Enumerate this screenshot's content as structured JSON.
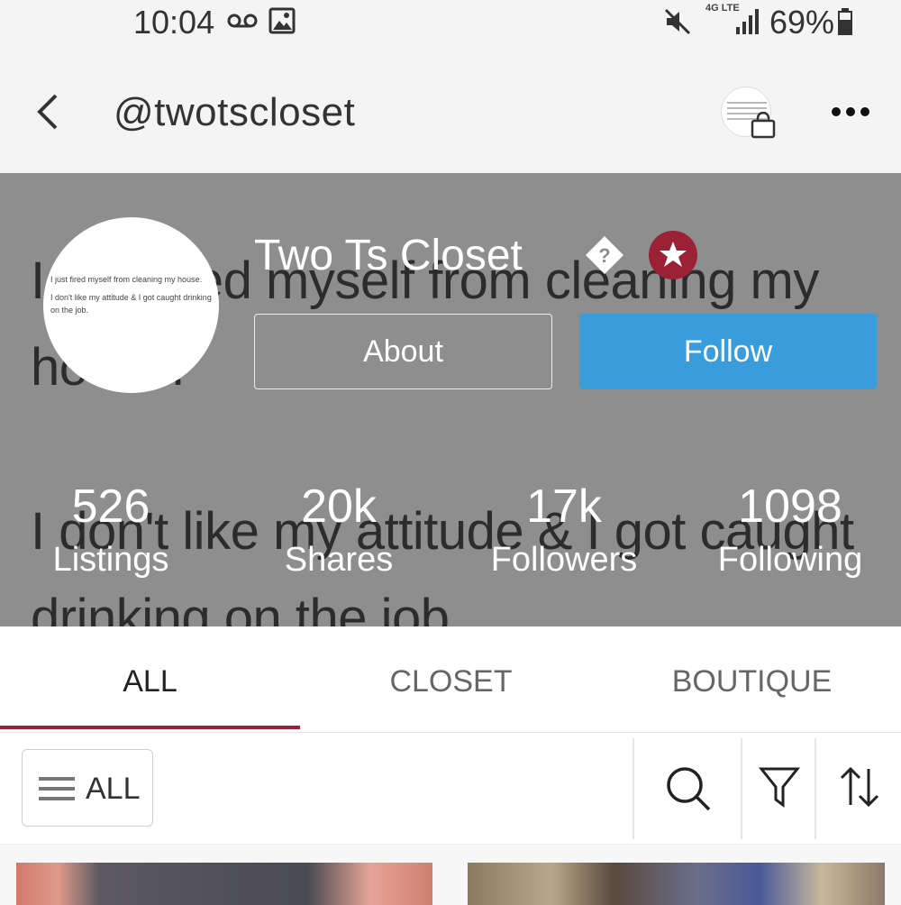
{
  "status_bar": {
    "time": "10:04",
    "network": "4G LTE",
    "battery": "69%"
  },
  "header": {
    "handle": "@twotscloset"
  },
  "profile": {
    "banner_lines": [
      "I just fired myself from cleaning my house.",
      "I don't like my attitude & I got caught drinking on the job."
    ],
    "avatar_lines": [
      "I just fired myself from cleaning my house.",
      "I don't like my attitude & I got caught drinking on the job."
    ],
    "shop_name": "Two Ts Closet",
    "about_label": "About",
    "follow_label": "Follow",
    "colors": {
      "follow": "#3a9ddb",
      "badge": "#9b2236",
      "banner": "#8e8e8e"
    }
  },
  "stats": [
    {
      "value": "526",
      "label": "Listings"
    },
    {
      "value": "20k",
      "label": "Shares"
    },
    {
      "value": "17k",
      "label": "Followers"
    },
    {
      "value": "1098",
      "label": "Following"
    }
  ],
  "tabs": [
    {
      "label": "ALL",
      "active": true
    },
    {
      "label": "CLOSET",
      "active": false
    },
    {
      "label": "BOUTIQUE",
      "active": false
    }
  ],
  "filter": {
    "all_label": "ALL",
    "icons": [
      "search-icon",
      "filter-icon",
      "sort-icon"
    ]
  }
}
